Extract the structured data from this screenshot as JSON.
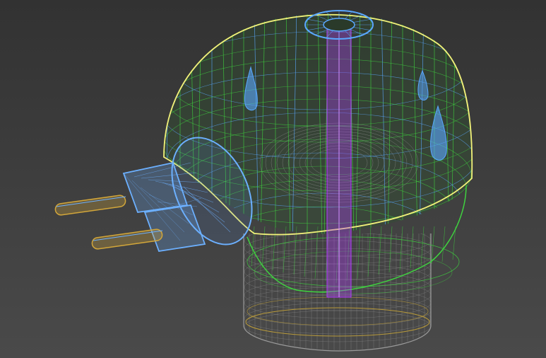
{
  "viewport": {
    "background_top": "#323232",
    "background_bottom": "#4a4a4a",
    "render_mode": "wireframe"
  },
  "objects": [
    {
      "name": "dome-housing",
      "wire_color": "#3fd23f",
      "selected_outline_color": "#f2f27a"
    },
    {
      "name": "top-cap-ring",
      "wire_color": "#5aa8ff"
    },
    {
      "name": "center-shaft",
      "wire_color": "#b43cff"
    },
    {
      "name": "plug-body",
      "wire_color": "#6cb0ff"
    },
    {
      "name": "plug-pins",
      "wire_color": "#d2a63a"
    },
    {
      "name": "base-cylinder",
      "wire_color": "#9a9a9a",
      "inner_color": "#b89a3a"
    },
    {
      "name": "inner-droplets",
      "wire_color": "#5aa8ff"
    }
  ]
}
